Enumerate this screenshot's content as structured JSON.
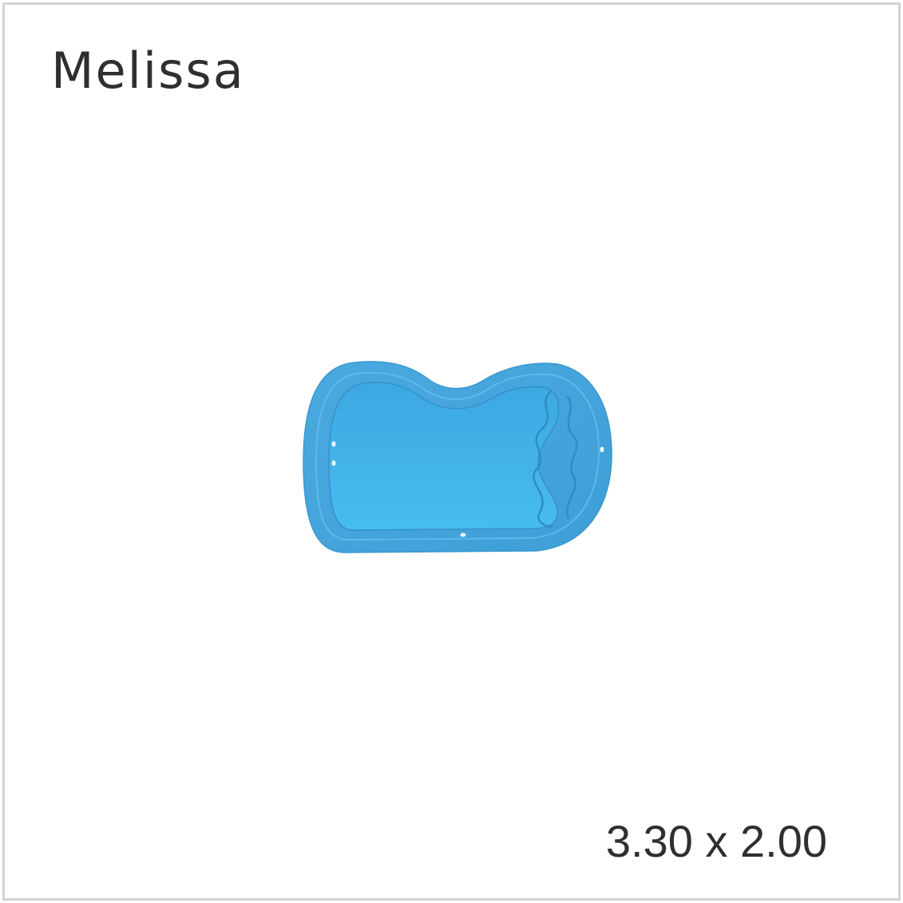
{
  "product": {
    "name": "Melissa",
    "dimensions": "3.30 x 2.00"
  },
  "image": {
    "icon": "kidney-pool-shell",
    "colors": {
      "pool_rim": "#46a6dd",
      "pool_inner": "#45b9ed",
      "pool_edge": "#3a98cf",
      "text": "#2f2f2f",
      "frame_border": "#d3d3d3"
    }
  }
}
